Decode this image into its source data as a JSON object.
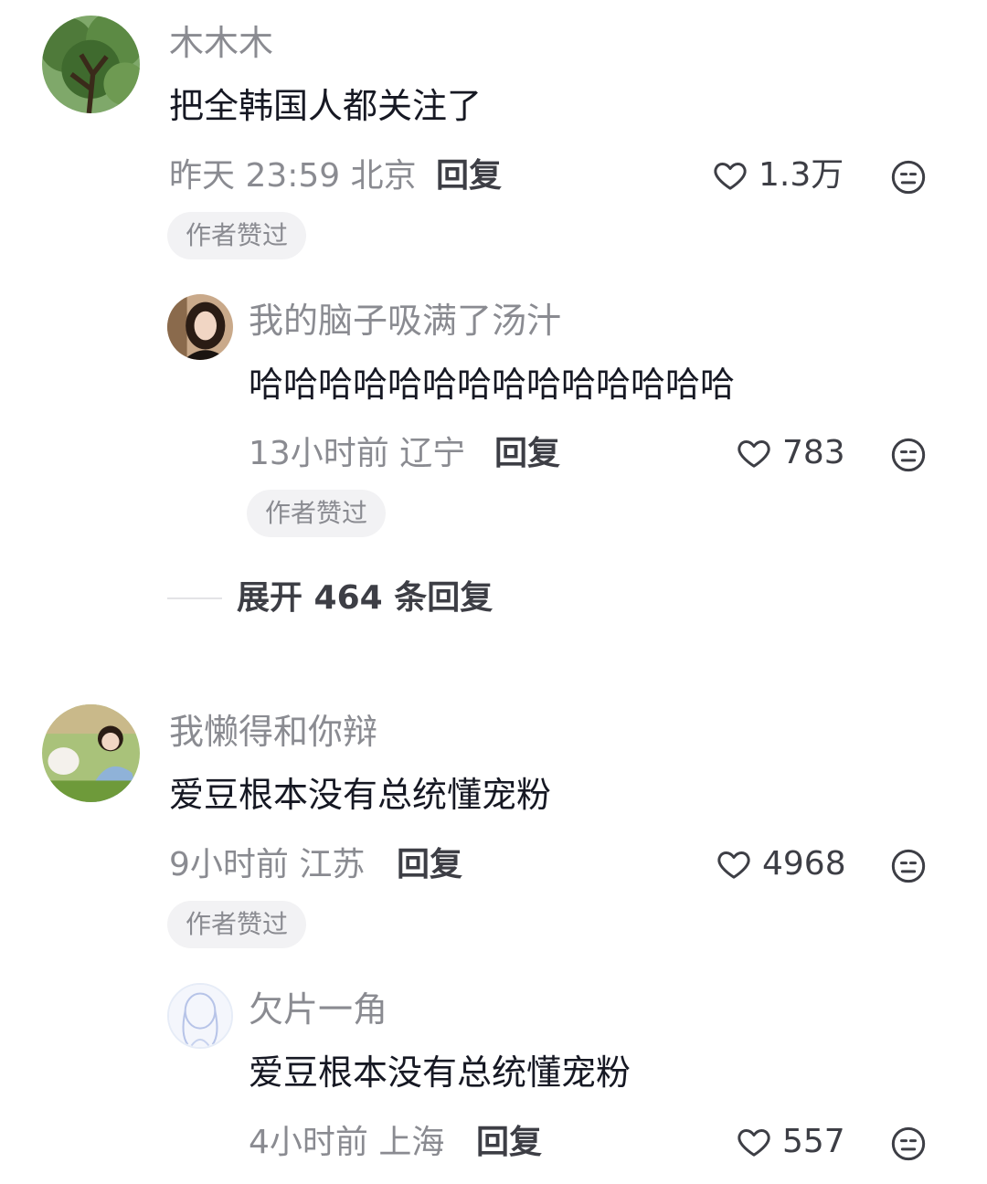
{
  "comments": [
    {
      "username": "木木木",
      "text": "把全韩国人都关注了",
      "time": "昨天 23:59",
      "location": "北京",
      "reply_label": "回复",
      "likes": "1.3万",
      "badge": "作者赞过",
      "avatar_icon": "tree-avatar"
    },
    {
      "username": "我的脑子吸满了汤汁",
      "text": "哈哈哈哈哈哈哈哈哈哈哈哈哈哈",
      "time": "13小时前",
      "location": "辽宁",
      "reply_label": "回复",
      "likes": "783",
      "badge": "作者赞过",
      "avatar_icon": "woman-portrait-avatar"
    },
    {
      "username": "我懒得和你辩",
      "text": "爱豆根本没有总统懂宠粉",
      "time": "9小时前",
      "location": "江苏",
      "reply_label": "回复",
      "likes": "4968",
      "badge": "作者赞过",
      "avatar_icon": "girl-with-dog-avatar"
    },
    {
      "username": "欠片一角",
      "text": "爱豆根本没有总统懂宠粉",
      "time": "4小时前",
      "location": "上海",
      "reply_label": "回复",
      "likes": "557",
      "avatar_icon": "anime-sketch-avatar"
    }
  ],
  "expand_replies_label": "展开 464 条回复",
  "icons": {
    "like": "heart-outline-icon",
    "dislike": "meh-face-icon"
  },
  "colors": {
    "primary_text": "#161823",
    "secondary_text": "#8a8b91",
    "badge_bg": "#f2f2f4"
  }
}
